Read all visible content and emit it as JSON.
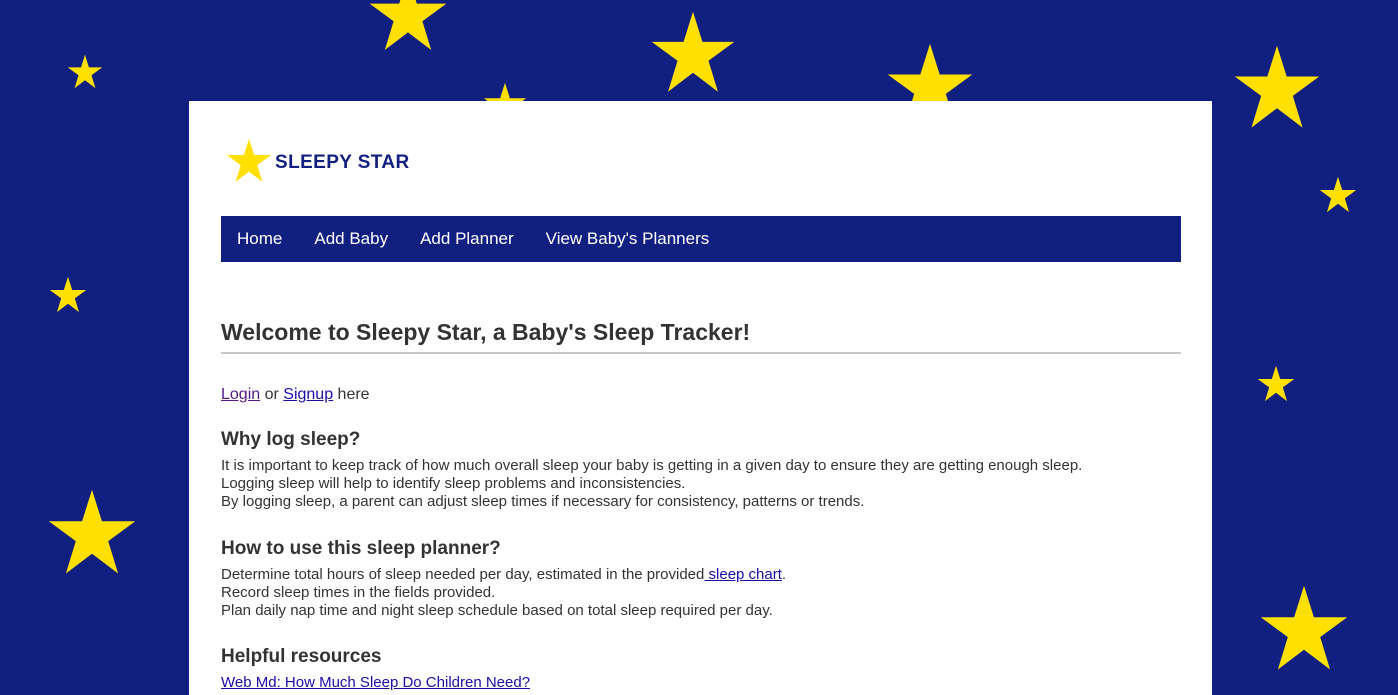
{
  "brand": {
    "name": "SLEEPY STAR",
    "star_color": "#FFE000",
    "navy": "#111F80"
  },
  "nav": {
    "items": [
      "Home",
      "Add Baby",
      "Add Planner",
      "View Baby's Planners"
    ]
  },
  "main": {
    "title": "Welcome to Sleepy Star, a Baby's Sleep Tracker!",
    "auth": {
      "login": "Login",
      "or": " or ",
      "signup": "Signup",
      "here": " here"
    },
    "why": {
      "heading": "Why log sleep?",
      "lines": [
        "It is important to keep track of how much overall sleep your baby is getting in a given day to ensure they are getting enough sleep.",
        "Logging sleep will help to identify sleep problems and inconsistencies.",
        "By logging sleep, a parent can adjust sleep times if necessary for consistency, patterns or trends."
      ]
    },
    "how": {
      "heading": "How to use this sleep planner?",
      "line1_pre": "Determine total hours of sleep needed per day, estimated in the provided",
      "line1_link": " sleep chart",
      "line1_post": ".",
      "line2": "Record sleep times in the fields provided.",
      "line3": "Plan daily nap time and night sleep schedule based on total sleep required per day."
    },
    "resources": {
      "heading": "Helpful resources",
      "link1": "Web Md: How Much Sleep Do Children Need?"
    }
  },
  "background": {
    "icon": "star-icon"
  }
}
